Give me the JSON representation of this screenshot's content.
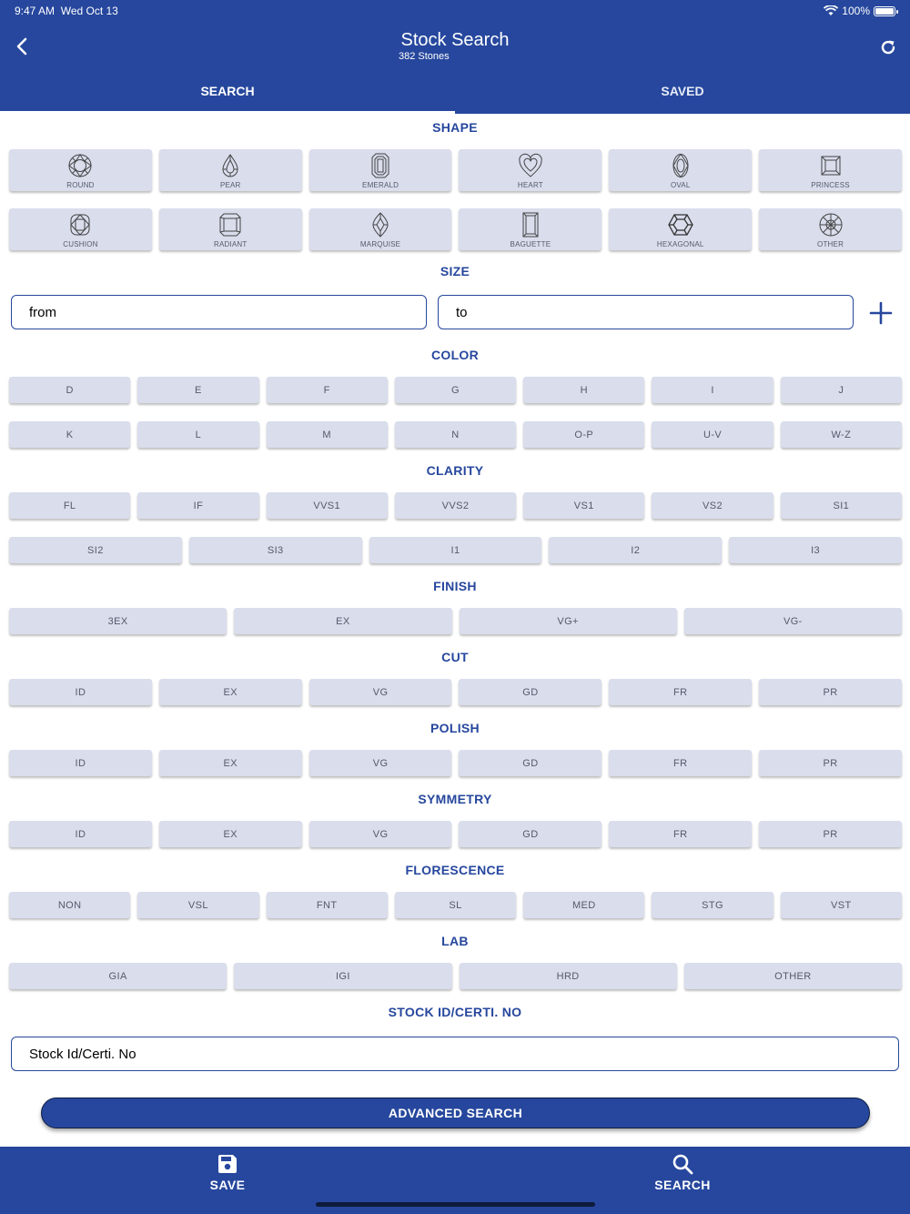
{
  "status_bar": {
    "time": "9:47 AM",
    "date": "Wed Oct 13",
    "battery": "100%"
  },
  "header": {
    "title": "Stock Search",
    "subtitle": "382 Stones"
  },
  "tabs": [
    {
      "label": "SEARCH",
      "active": true
    },
    {
      "label": "SAVED",
      "active": false
    }
  ],
  "sections": {
    "shape": "SHAPE",
    "size": "SIZE",
    "color": "COLOR",
    "clarity": "CLARITY",
    "finish": "FINISH",
    "cut": "CUT",
    "polish": "POLISH",
    "symmetry": "SYMMETRY",
    "florescence": "FLORESCENCE",
    "lab": "LAB",
    "stock_id": "STOCK ID/CERTI. NO"
  },
  "shapes": [
    {
      "label": "ROUND",
      "icon": "round-diamond-icon"
    },
    {
      "label": "PEAR",
      "icon": "pear-diamond-icon"
    },
    {
      "label": "EMERALD",
      "icon": "emerald-diamond-icon"
    },
    {
      "label": "HEART",
      "icon": "heart-diamond-icon"
    },
    {
      "label": "OVAL",
      "icon": "oval-diamond-icon"
    },
    {
      "label": "PRINCESS",
      "icon": "princess-diamond-icon"
    },
    {
      "label": "CUSHION",
      "icon": "cushion-diamond-icon"
    },
    {
      "label": "RADIANT",
      "icon": "radiant-diamond-icon"
    },
    {
      "label": "MARQUISE",
      "icon": "marquise-diamond-icon"
    },
    {
      "label": "BAGUETTE",
      "icon": "baguette-diamond-icon"
    },
    {
      "label": "HEXAGONAL",
      "icon": "hexagonal-diamond-icon"
    },
    {
      "label": "OTHER",
      "icon": "other-shape-icon"
    }
  ],
  "size": {
    "from_placeholder": "from",
    "to_placeholder": "to"
  },
  "color_options": [
    [
      "D",
      "E",
      "F",
      "G",
      "H",
      "I",
      "J"
    ],
    [
      "K",
      "L",
      "M",
      "N",
      "O-P",
      "U-V",
      "W-Z"
    ]
  ],
  "clarity_options": [
    [
      "FL",
      "IF",
      "VVS1",
      "VVS2",
      "VS1",
      "VS2",
      "SI1"
    ],
    [
      "SI2",
      "SI3",
      "I1",
      "I2",
      "I3"
    ]
  ],
  "finish_options": [
    "3EX",
    "EX",
    "VG+",
    "VG-"
  ],
  "cut_options": [
    "ID",
    "EX",
    "VG",
    "GD",
    "FR",
    "PR"
  ],
  "polish_options": [
    "ID",
    "EX",
    "VG",
    "GD",
    "FR",
    "PR"
  ],
  "symmetry_options": [
    "ID",
    "EX",
    "VG",
    "GD",
    "FR",
    "PR"
  ],
  "florescence_options": [
    "NON",
    "VSL",
    "FNT",
    "SL",
    "MED",
    "STG",
    "VST"
  ],
  "lab_options": [
    "GIA",
    "IGI",
    "HRD",
    "OTHER"
  ],
  "stock_id": {
    "placeholder": "Stock Id/Certi. No"
  },
  "advanced_search_label": "ADVANCED SEARCH",
  "bottom_bar": {
    "save_label": "SAVE",
    "search_label": "SEARCH"
  },
  "colors": {
    "primary": "#26479d",
    "chip_bg": "#d9ddec",
    "chip_text": "#55596b"
  }
}
